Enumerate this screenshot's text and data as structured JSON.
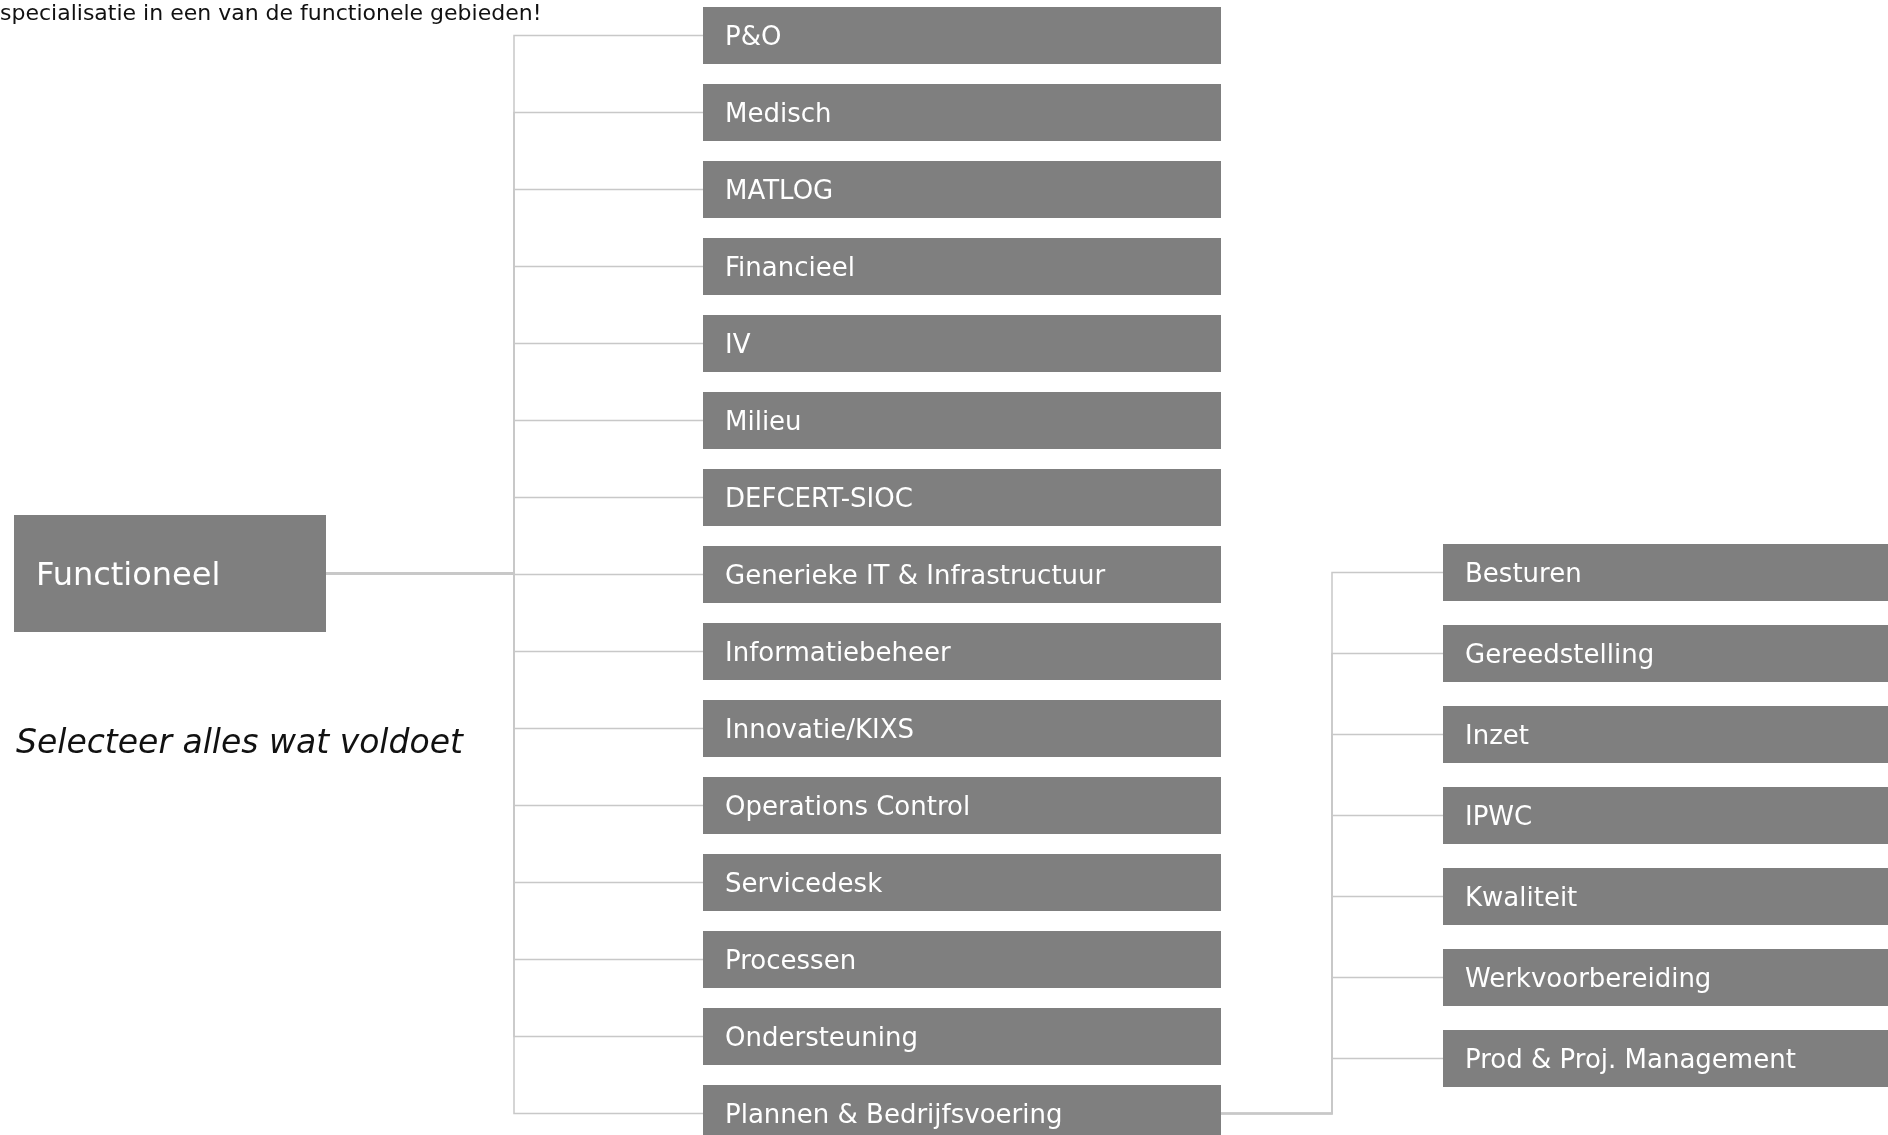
{
  "intro": "specialisatie in een van de functionele gebieden!",
  "root": {
    "label": "Functioneel"
  },
  "instruction": "Selecteer alles wat voldoet",
  "categories": [
    {
      "label": "P&O"
    },
    {
      "label": "Medisch"
    },
    {
      "label": "MATLOG"
    },
    {
      "label": "Financieel"
    },
    {
      "label": "IV"
    },
    {
      "label": "Milieu"
    },
    {
      "label": "DEFCERT-SIOC"
    },
    {
      "label": "Generieke IT & Infrastructuur"
    },
    {
      "label": "Informatiebeheer"
    },
    {
      "label": "Innovatie/KIXS"
    },
    {
      "label": "Operations Control"
    },
    {
      "label": "Servicedesk"
    },
    {
      "label": "Processen"
    },
    {
      "label": "Ondersteuning"
    },
    {
      "label": "Plannen & Bedrijfsvoering",
      "children": [
        {
          "label": "Besturen"
        },
        {
          "label": "Gereedstelling"
        },
        {
          "label": "Inzet"
        },
        {
          "label": "IPWC"
        },
        {
          "label": "Kwaliteit"
        },
        {
          "label": "Werkvoorbereiding"
        },
        {
          "label": "Prod & Proj. Management"
        }
      ]
    }
  ]
}
